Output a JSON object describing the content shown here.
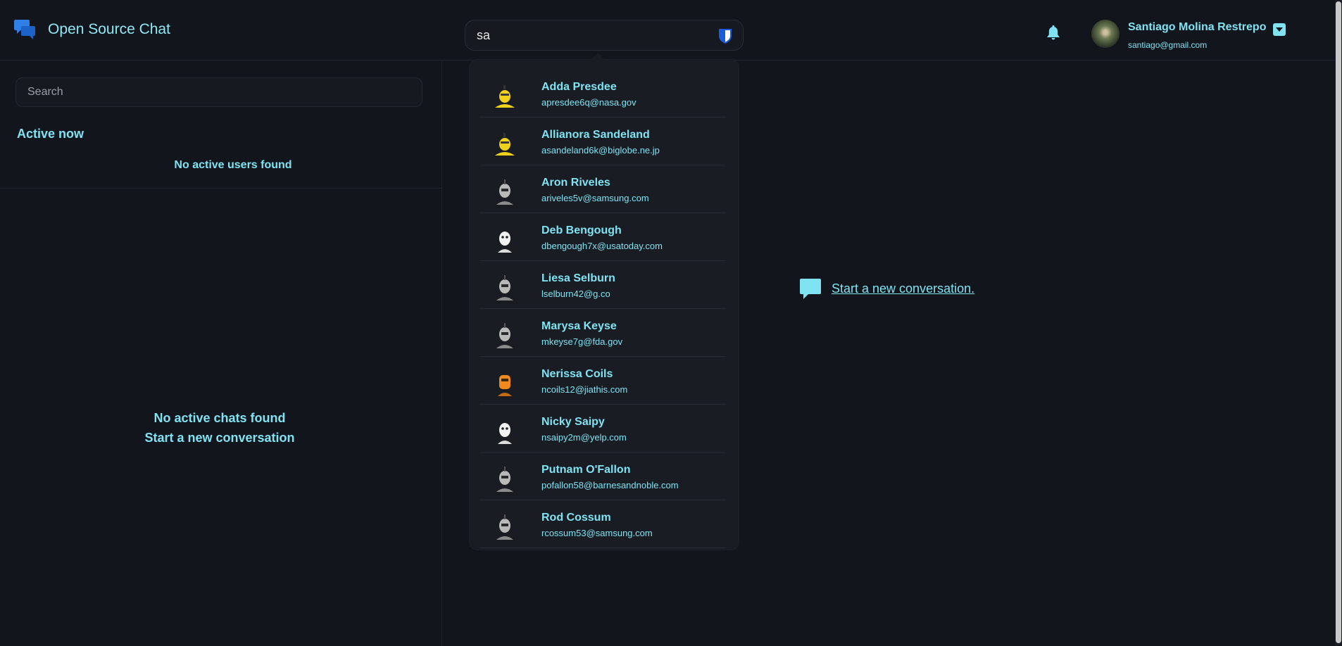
{
  "header": {
    "title": "Open Source Chat",
    "search_value": "sa",
    "user": {
      "name": "Santiago Molina Restrepo",
      "email": "santiago@gmail.com"
    }
  },
  "sidebar": {
    "search_placeholder": "Search",
    "active_title": "Active now",
    "no_active": "No active users found",
    "no_chats_line1": "No active chats found",
    "no_chats_line2": "Start a new conversation"
  },
  "main": {
    "new_conversation": "Start a new conversation."
  },
  "results": [
    {
      "name": "Adda Presdee",
      "email": "apresdee6q@nasa.gov",
      "avatar": "yellow-bot"
    },
    {
      "name": "Allianora Sandeland",
      "email": "asandeland6k@biglobe.ne.jp",
      "avatar": "yellow-bot"
    },
    {
      "name": "Aron Riveles",
      "email": "ariveles5v@samsung.com",
      "avatar": "gray-bot"
    },
    {
      "name": "Deb Bengough",
      "email": "dbengough7x@usatoday.com",
      "avatar": "white-bot"
    },
    {
      "name": "Liesa Selburn",
      "email": "lselburn42@g.co",
      "avatar": "gray-bot"
    },
    {
      "name": "Marysa Keyse",
      "email": "mkeyse7g@fda.gov",
      "avatar": "gray-bot"
    },
    {
      "name": "Nerissa Coils",
      "email": "ncoils12@jiathis.com",
      "avatar": "orange-bot"
    },
    {
      "name": "Nicky Saipy",
      "email": "nsaipy2m@yelp.com",
      "avatar": "white-bot"
    },
    {
      "name": "Putnam O'Fallon",
      "email": "pofallon58@barnesandnoble.com",
      "avatar": "gray-bot"
    },
    {
      "name": "Rod Cossum",
      "email": "rcossum53@samsung.com",
      "avatar": "gray-bot"
    }
  ],
  "colors": {
    "background": "#13151d",
    "accent": "#7fe3f2",
    "brand_blue": "#2f7fe6"
  }
}
